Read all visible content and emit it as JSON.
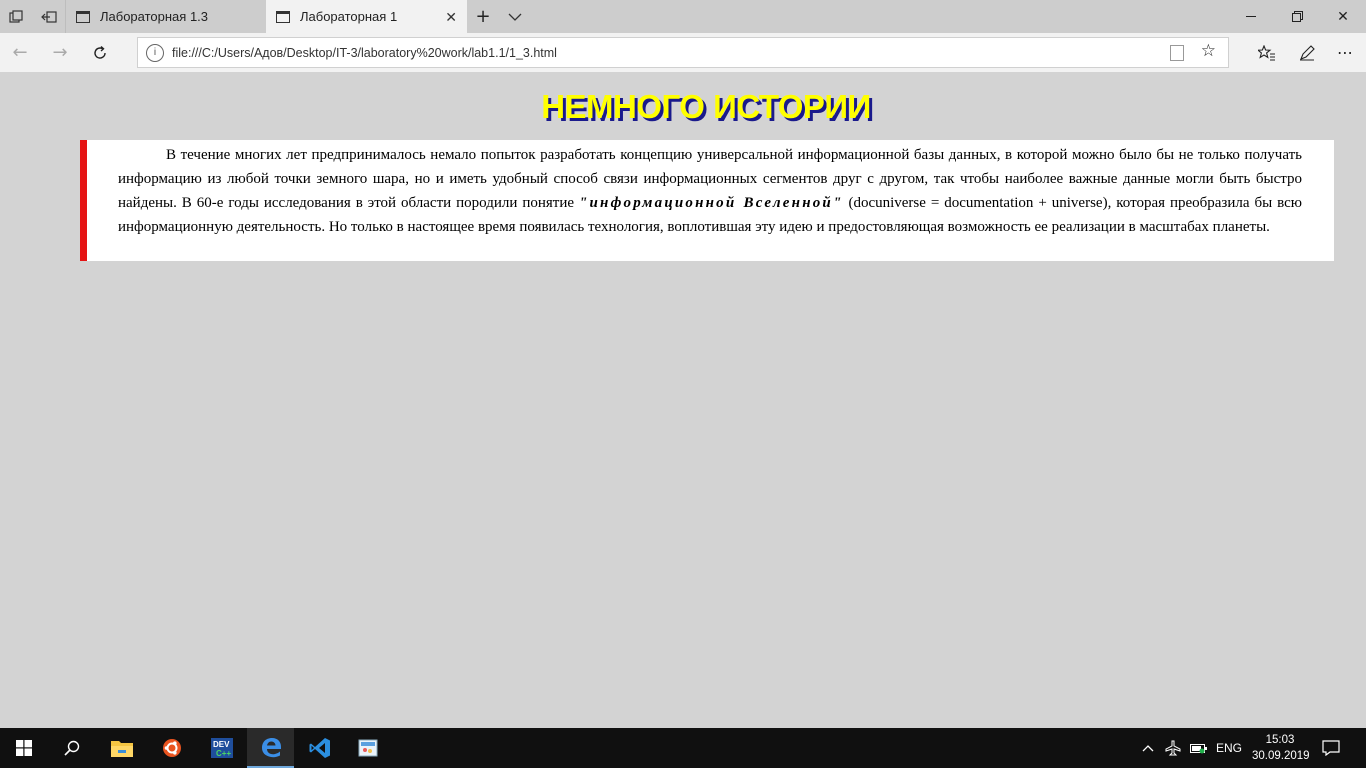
{
  "browser": {
    "tabs": [
      {
        "title": "Лабораторная 1.3",
        "active": false
      },
      {
        "title": "Лабораторная 1",
        "active": true
      }
    ],
    "url": "file:///C:/Users/Адов/Desktop/IT-3/laboratory%20work/lab1.1/1_3.html"
  },
  "page": {
    "title": "НЕМНОГО ИСТОРИИ",
    "paragraph_part1": "В течение многих лет предпринималось немало попыток разработать концепцию универсальной информационной базы данных, в которой можно было бы не только получать информацию из любой точки земного шара, но и иметь удобный способ связи информационных сегментов друг с другом, так чтобы наиболее важные данные могли быть быстро найдены. В 60-е годы исследования в этой области породили понятие ",
    "paragraph_term": "\"информационной Вселенной\"",
    "paragraph_part2": " (docuniverse = documentation + universe), которая преобразила бы всю информационную деятельность. Но только в настоящее время появилась технология, воплотившая эту идею и предостовляющая возможность ее реализации в масштабах планеты.",
    "accent_color": "#e51414",
    "title_color": "#ffff00",
    "title_shadow_color": "#1a1a8c"
  },
  "taskbar": {
    "language": "ENG",
    "time": "15:03",
    "date": "30.09.2019",
    "apps": [
      "file-explorer",
      "ubuntu",
      "devcpp",
      "edge",
      "vscode",
      "paint"
    ]
  }
}
